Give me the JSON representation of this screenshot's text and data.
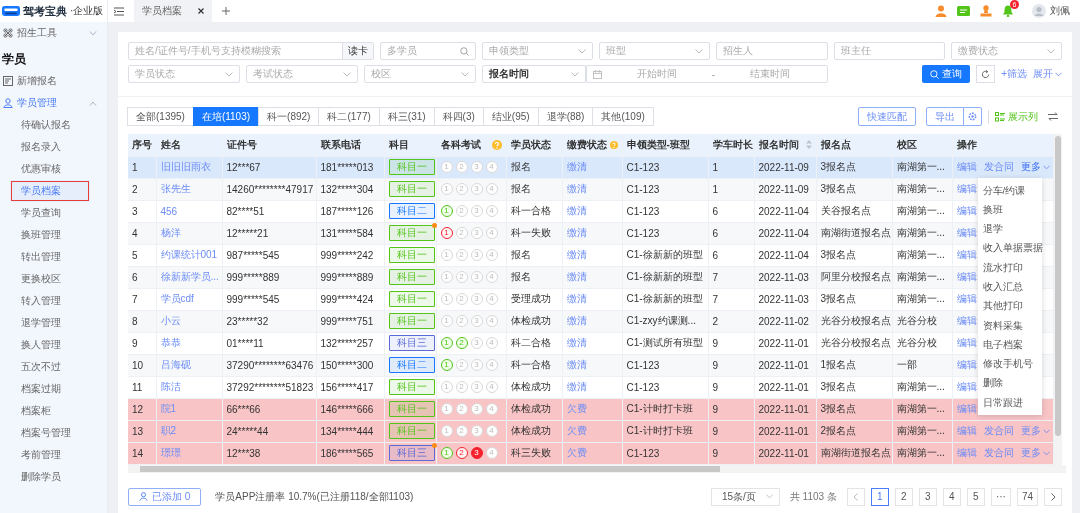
{
  "sidebar": {
    "brand": "驾考宝典",
    "edition": "·企业版",
    "items": [
      {
        "label": "招生工具",
        "kind": "group",
        "expanded": false,
        "active": false
      },
      {
        "label": "学员",
        "kind": "heading"
      },
      {
        "label": "新增报名",
        "kind": "link",
        "active": false
      },
      {
        "label": "学员管理",
        "kind": "group",
        "expanded": true,
        "active": true,
        "children": [
          {
            "label": "待确认报名",
            "selected": false,
            "annotated": false
          },
          {
            "label": "报名录入",
            "selected": false,
            "annotated": false
          },
          {
            "label": "优惠审核",
            "selected": false,
            "annotated": false
          },
          {
            "label": "学员档案",
            "selected": true,
            "annotated": true
          },
          {
            "label": "学员查询",
            "selected": false,
            "annotated": false
          },
          {
            "label": "换班管理",
            "selected": false,
            "annotated": false
          },
          {
            "label": "转出管理",
            "selected": false,
            "annotated": false
          },
          {
            "label": "更换校区",
            "selected": false,
            "annotated": false
          },
          {
            "label": "转入管理",
            "selected": false,
            "annotated": false
          },
          {
            "label": "退学管理",
            "selected": false,
            "annotated": false
          },
          {
            "label": "换人管理",
            "selected": false,
            "annotated": false
          },
          {
            "label": "五次不过",
            "selected": false,
            "annotated": false
          },
          {
            "label": "档案过期",
            "selected": false,
            "annotated": false
          },
          {
            "label": "档案柜",
            "selected": false,
            "annotated": false
          },
          {
            "label": "档案号管理",
            "selected": false,
            "annotated": false
          },
          {
            "label": "考前管理",
            "selected": false,
            "annotated": false
          },
          {
            "label": "删除学员",
            "selected": false,
            "annotated": false
          }
        ]
      }
    ]
  },
  "topbar": {
    "tabs": [
      {
        "label": "学员档案",
        "selected": true
      }
    ],
    "notification_count": "6",
    "user": "刘佩"
  },
  "filters": {
    "row_1": [
      {
        "kind": "input-button",
        "placeholder": "姓名/证件号/手机号支持模糊搜索",
        "button": "读卡"
      },
      {
        "kind": "search",
        "placeholder": "多学员"
      },
      {
        "kind": "select",
        "placeholder": "申领类型"
      },
      {
        "kind": "select",
        "placeholder": "班型"
      },
      {
        "kind": "input",
        "placeholder": "招生人"
      },
      {
        "kind": "input",
        "placeholder": "班主任"
      },
      {
        "kind": "select",
        "placeholder": "缴费状态"
      }
    ],
    "row_2": [
      {
        "kind": "select",
        "placeholder": "学员状态"
      },
      {
        "kind": "select",
        "placeholder": "考试状态"
      },
      {
        "kind": "select",
        "placeholder": "校区"
      },
      {
        "kind": "select",
        "value": "报名时间"
      },
      {
        "kind": "daterange",
        "start_placeholder": "开始时间",
        "separator": "-",
        "end_placeholder": "结束时间"
      }
    ],
    "query": "查询",
    "add_filter": "+筛选",
    "expand": "展开"
  },
  "status_tabs": [
    {
      "label": "全部(1395)",
      "selected": false
    },
    {
      "label": "在培(1103)",
      "selected": true
    },
    {
      "label": "科一(892)",
      "selected": false
    },
    {
      "label": "科二(177)",
      "selected": false
    },
    {
      "label": "科三(31)",
      "selected": false
    },
    {
      "label": "科四(3)",
      "selected": false
    },
    {
      "label": "结业(95)",
      "selected": false
    },
    {
      "label": "退学(88)",
      "selected": false
    },
    {
      "label": "其他(109)",
      "selected": false
    }
  ],
  "toolbar": {
    "match": "快速匹配",
    "export": "导出",
    "columns": "展示列"
  },
  "table": {
    "columns": [
      {
        "label": "序号",
        "kind": "plain"
      },
      {
        "label": "姓名",
        "kind": "plain"
      },
      {
        "label": "证件号",
        "kind": "plain"
      },
      {
        "label": "联系电话",
        "kind": "plain"
      },
      {
        "label": "科目",
        "kind": "plain"
      },
      {
        "label": "各科考试",
        "kind": "help"
      },
      {
        "label": "学员状态",
        "kind": "plain"
      },
      {
        "label": "缴费状态",
        "kind": "help"
      },
      {
        "label": "申领类型-班型",
        "kind": "plain"
      },
      {
        "label": "学车时长",
        "kind": "plain"
      },
      {
        "label": "报名时间",
        "kind": "sort"
      },
      {
        "label": "报名点",
        "kind": "plain"
      },
      {
        "label": "校区",
        "kind": "plain"
      },
      {
        "label": "操作",
        "kind": "plain"
      }
    ],
    "rows": [
      {
        "no": "1",
        "name": "旧旧旧雨衣",
        "id_no": "12***67",
        "phone": "181*****013",
        "subject": {
          "label": "科目一",
          "color": "#52c41a",
          "flag": false
        },
        "exams": [
          {
            "label": "1",
            "passed": false,
            "failed": false,
            "highlighted": false
          },
          {
            "label": "2",
            "passed": false,
            "failed": false,
            "highlighted": false
          },
          {
            "label": "3",
            "passed": false,
            "failed": false,
            "highlighted": false
          },
          {
            "label": "4",
            "passed": false,
            "failed": false,
            "highlighted": false
          }
        ],
        "status": "报名",
        "payment": "缴清",
        "class_type": "C1-123",
        "hours": "1",
        "date": "2022-11-09",
        "site": "3报名点",
        "campus": "南湖第一...",
        "selected": true,
        "overdue": false,
        "actions": [
          {
            "label": "编辑",
            "kind": "link"
          },
          {
            "label": "发合同",
            "kind": "link"
          },
          {
            "label": "更多",
            "kind": "menu",
            "open": true
          }
        ]
      },
      {
        "no": "2",
        "name": "张先生",
        "id_no": "14260********47917",
        "phone": "132*****304",
        "subject": {
          "label": "科目一",
          "color": "#52c41a",
          "flag": false
        },
        "exams": [
          {
            "label": "1",
            "passed": false,
            "failed": false,
            "highlighted": false
          },
          {
            "label": "2",
            "passed": false,
            "failed": false,
            "highlighted": false
          },
          {
            "label": "3",
            "passed": false,
            "failed": false,
            "highlighted": false
          },
          {
            "label": "4",
            "passed": false,
            "failed": false,
            "highlighted": false
          }
        ],
        "status": "报名",
        "payment": "缴清",
        "class_type": "C1-123",
        "hours": "1",
        "date": "2022-11-09",
        "site": "3报名点",
        "campus": "南湖第一...",
        "selected": false,
        "overdue": false,
        "actions": [
          {
            "label": "编辑",
            "kind": "link"
          }
        ]
      },
      {
        "no": "3",
        "name": "456",
        "id_no": "82****51",
        "phone": "187*****126",
        "subject": {
          "label": "科目二",
          "color": "#1677ff",
          "flag": false
        },
        "exams": [
          {
            "label": "1",
            "passed": true,
            "failed": false,
            "highlighted": false
          },
          {
            "label": "2",
            "passed": false,
            "failed": false,
            "highlighted": false
          },
          {
            "label": "3",
            "passed": false,
            "failed": false,
            "highlighted": false
          },
          {
            "label": "4",
            "passed": false,
            "failed": false,
            "highlighted": false
          }
        ],
        "status": "科一合格",
        "payment": "缴清",
        "class_type": "C1-123",
        "hours": "6",
        "date": "2022-11-04",
        "site": "关谷报名点",
        "campus": "南湖第一...",
        "selected": false,
        "overdue": false,
        "actions": [
          {
            "label": "编辑",
            "kind": "link"
          }
        ]
      },
      {
        "no": "4",
        "name": "杨洋",
        "id_no": "12*****21",
        "phone": "131*****584",
        "subject": {
          "label": "科目一",
          "color": "#52c41a",
          "flag": true
        },
        "exams": [
          {
            "label": "1",
            "passed": false,
            "failed": true,
            "highlighted": false
          },
          {
            "label": "2",
            "passed": false,
            "failed": false,
            "highlighted": false
          },
          {
            "label": "3",
            "passed": false,
            "failed": false,
            "highlighted": false
          },
          {
            "label": "4",
            "passed": false,
            "failed": false,
            "highlighted": false
          }
        ],
        "status": "科一失败",
        "payment": "缴清",
        "class_type": "C1-123",
        "hours": "6",
        "date": "2022-11-04",
        "site": "南湖街道报名点",
        "campus": "南湖第一...",
        "selected": false,
        "overdue": false,
        "actions": [
          {
            "label": "编辑",
            "kind": "link"
          }
        ]
      },
      {
        "no": "5",
        "name": "约课统计001",
        "id_no": "987*****545",
        "phone": "999*****242",
        "subject": {
          "label": "科目一",
          "color": "#52c41a",
          "flag": false
        },
        "exams": [
          {
            "label": "1",
            "passed": false,
            "failed": false,
            "highlighted": false
          },
          {
            "label": "2",
            "passed": false,
            "failed": false,
            "highlighted": false
          },
          {
            "label": "3",
            "passed": false,
            "failed": false,
            "highlighted": false
          },
          {
            "label": "4",
            "passed": false,
            "failed": false,
            "highlighted": false
          }
        ],
        "status": "报名",
        "payment": "缴清",
        "class_type": "C1-徐新新的班型",
        "hours": "6",
        "date": "2022-11-04",
        "site": "3报名点",
        "campus": "南湖第一...",
        "selected": false,
        "overdue": false,
        "actions": [
          {
            "label": "编辑",
            "kind": "link"
          }
        ]
      },
      {
        "no": "6",
        "name": "徐新新学员...",
        "id_no": "999*****889",
        "phone": "999*****889",
        "subject": {
          "label": "科目一",
          "color": "#52c41a",
          "flag": false
        },
        "exams": [
          {
            "label": "1",
            "passed": false,
            "failed": false,
            "highlighted": false
          },
          {
            "label": "2",
            "passed": false,
            "failed": false,
            "highlighted": false
          },
          {
            "label": "3",
            "passed": false,
            "failed": false,
            "highlighted": false
          },
          {
            "label": "4",
            "passed": false,
            "failed": false,
            "highlighted": false
          }
        ],
        "status": "报名",
        "payment": "缴清",
        "class_type": "C1-徐新新的班型",
        "hours": "7",
        "date": "2022-11-03",
        "site": "阿里分校报名点",
        "campus": "南湖第一...",
        "selected": false,
        "overdue": false,
        "actions": [
          {
            "label": "编辑",
            "kind": "link"
          }
        ]
      },
      {
        "no": "7",
        "name": "学员cdf",
        "id_no": "999*****545",
        "phone": "999*****424",
        "subject": {
          "label": "科目一",
          "color": "#52c41a",
          "flag": false
        },
        "exams": [
          {
            "label": "1",
            "passed": false,
            "failed": false,
            "highlighted": false
          },
          {
            "label": "2",
            "passed": false,
            "failed": false,
            "highlighted": false
          },
          {
            "label": "3",
            "passed": false,
            "failed": false,
            "highlighted": false
          },
          {
            "label": "4",
            "passed": false,
            "failed": false,
            "highlighted": false
          }
        ],
        "status": "受理成功",
        "payment": "缴清",
        "class_type": "C1-徐新新的班型",
        "hours": "7",
        "date": "2022-11-03",
        "site": "3报名点",
        "campus": "南湖第一...",
        "selected": false,
        "overdue": false,
        "actions": [
          {
            "label": "编辑",
            "kind": "link"
          }
        ]
      },
      {
        "no": "8",
        "name": "小云",
        "id_no": "23*****32",
        "phone": "999*****751",
        "subject": {
          "label": "科目一",
          "color": "#52c41a",
          "flag": false
        },
        "exams": [
          {
            "label": "1",
            "passed": false,
            "failed": false,
            "highlighted": false
          },
          {
            "label": "2",
            "passed": false,
            "failed": false,
            "highlighted": false
          },
          {
            "label": "3",
            "passed": false,
            "failed": false,
            "highlighted": false
          },
          {
            "label": "4",
            "passed": false,
            "failed": false,
            "highlighted": false
          }
        ],
        "status": "体检成功",
        "payment": "缴清",
        "class_type": "C1-zxy约课测...",
        "hours": "2",
        "date": "2022-11-02",
        "site": "光谷分校报名点",
        "campus": "光谷分校",
        "selected": false,
        "overdue": false,
        "actions": [
          {
            "label": "编辑",
            "kind": "link"
          }
        ]
      },
      {
        "no": "9",
        "name": "恭恭",
        "id_no": "01****11",
        "phone": "132*****257",
        "subject": {
          "label": "科目三",
          "color": "#5b6ad6",
          "flag": false
        },
        "exams": [
          {
            "label": "1",
            "passed": true,
            "failed": false,
            "highlighted": false
          },
          {
            "label": "2",
            "passed": true,
            "failed": false,
            "highlighted": false
          },
          {
            "label": "3",
            "passed": false,
            "failed": false,
            "highlighted": false
          },
          {
            "label": "4",
            "passed": false,
            "failed": false,
            "highlighted": false
          }
        ],
        "status": "科二合格",
        "payment": "缴清",
        "class_type": "C1-测试所有班型",
        "hours": "9",
        "date": "2022-11-01",
        "site": "光谷分校报名点",
        "campus": "光谷分校",
        "selected": false,
        "overdue": false,
        "actions": [
          {
            "label": "编辑",
            "kind": "link"
          }
        ]
      },
      {
        "no": "10",
        "name": "吕海砚",
        "id_no": "37290********63476",
        "phone": "150*****300",
        "subject": {
          "label": "科目二",
          "color": "#1677ff",
          "flag": false
        },
        "exams": [
          {
            "label": "1",
            "passed": true,
            "failed": false,
            "highlighted": false
          },
          {
            "label": "2",
            "passed": false,
            "failed": false,
            "highlighted": false
          },
          {
            "label": "3",
            "passed": false,
            "failed": false,
            "highlighted": false
          },
          {
            "label": "4",
            "passed": false,
            "failed": false,
            "highlighted": false
          }
        ],
        "status": "科一合格",
        "payment": "缴清",
        "class_type": "C1-123",
        "hours": "9",
        "date": "2022-11-01",
        "site": "1报名点",
        "campus": "一部",
        "selected": false,
        "overdue": false,
        "actions": [
          {
            "label": "编辑",
            "kind": "link"
          }
        ]
      },
      {
        "no": "11",
        "name": "陈洁",
        "id_no": "37292********51823",
        "phone": "156*****417",
        "subject": {
          "label": "科目一",
          "color": "#52c41a",
          "flag": false
        },
        "exams": [
          {
            "label": "1",
            "passed": false,
            "failed": false,
            "highlighted": false
          },
          {
            "label": "2",
            "passed": false,
            "failed": false,
            "highlighted": false
          },
          {
            "label": "3",
            "passed": false,
            "failed": false,
            "highlighted": false
          },
          {
            "label": "4",
            "passed": false,
            "failed": false,
            "highlighted": false
          }
        ],
        "status": "体检成功",
        "payment": "缴清",
        "class_type": "C1-123",
        "hours": "9",
        "date": "2022-11-01",
        "site": "3报名点",
        "campus": "南湖第一...",
        "selected": false,
        "overdue": false,
        "actions": [
          {
            "label": "编辑",
            "kind": "link"
          }
        ]
      },
      {
        "no": "12",
        "name": "院1",
        "id_no": "66***66",
        "phone": "146*****666",
        "subject": {
          "label": "科目一",
          "color": "#52c41a",
          "flag": false
        },
        "exams": [
          {
            "label": "1",
            "passed": false,
            "failed": false,
            "highlighted": false
          },
          {
            "label": "2",
            "passed": false,
            "failed": false,
            "highlighted": false
          },
          {
            "label": "3",
            "passed": false,
            "failed": false,
            "highlighted": false
          },
          {
            "label": "4",
            "passed": false,
            "failed": false,
            "highlighted": false
          }
        ],
        "status": "体检成功",
        "payment": "欠费",
        "class_type": "C1-计时打卡班",
        "hours": "9",
        "date": "2022-11-01",
        "site": "3报名点",
        "campus": "南湖第一...",
        "selected": false,
        "overdue": true,
        "actions": [
          {
            "label": "编辑",
            "kind": "link"
          }
        ]
      },
      {
        "no": "13",
        "name": "职2",
        "id_no": "24*****44",
        "phone": "134*****444",
        "subject": {
          "label": "科目一",
          "color": "#52c41a",
          "flag": false
        },
        "exams": [
          {
            "label": "1",
            "passed": false,
            "failed": false,
            "highlighted": false
          },
          {
            "label": "2",
            "passed": false,
            "failed": false,
            "highlighted": false
          },
          {
            "label": "3",
            "passed": false,
            "failed": false,
            "highlighted": false
          },
          {
            "label": "4",
            "passed": false,
            "failed": false,
            "highlighted": false
          }
        ],
        "status": "体检成功",
        "payment": "欠费",
        "class_type": "C1-计时打卡班",
        "hours": "9",
        "date": "2022-11-01",
        "site": "2报名点",
        "campus": "南湖第一...",
        "selected": false,
        "overdue": true,
        "actions": [
          {
            "label": "编辑",
            "kind": "link"
          },
          {
            "label": "发合同",
            "kind": "link"
          },
          {
            "label": "更多",
            "kind": "menu",
            "open": false
          }
        ]
      },
      {
        "no": "14",
        "name": "璟璟",
        "id_no": "12***38",
        "phone": "186*****565",
        "subject": {
          "label": "科目三",
          "color": "#5b6ad6",
          "flag": true
        },
        "exams": [
          {
            "label": "1",
            "passed": true,
            "failed": false,
            "highlighted": false
          },
          {
            "label": "2",
            "passed": false,
            "failed": true,
            "highlighted": false
          },
          {
            "label": "3",
            "passed": false,
            "failed": true,
            "highlighted": true
          },
          {
            "label": "4",
            "passed": false,
            "failed": false,
            "highlighted": false
          }
        ],
        "status": "科三失败",
        "payment": "欠费",
        "class_type": "C1-123",
        "hours": "9",
        "date": "2022-11-01",
        "site": "南湖街道报名点",
        "campus": "南湖第一...",
        "selected": false,
        "overdue": true,
        "actions": [
          {
            "label": "编辑",
            "kind": "link"
          },
          {
            "label": "发合同",
            "kind": "link"
          },
          {
            "label": "更多",
            "kind": "menu",
            "open": false
          }
        ]
      }
    ],
    "more_menu": [
      "分车/约课",
      "换班",
      "退学",
      "收入单据票据",
      "流水打印",
      "收入汇总",
      "其他打印",
      "资料采集",
      "电子档案",
      "修改手机号",
      "删除",
      "日常跟进"
    ]
  },
  "footer": {
    "added": "已添加 0",
    "stats": "学员APP注册率 10.7%(已注册118/全部1103)",
    "page_size": "15条/页",
    "total": "共 1103 条",
    "pages": [
      {
        "label": "1",
        "selected": true
      },
      {
        "label": "2",
        "selected": false
      },
      {
        "label": "3",
        "selected": false
      },
      {
        "label": "4",
        "selected": false
      },
      {
        "label": "5",
        "selected": false
      },
      {
        "label": "···",
        "selected": false
      },
      {
        "label": "74",
        "selected": false
      }
    ]
  }
}
